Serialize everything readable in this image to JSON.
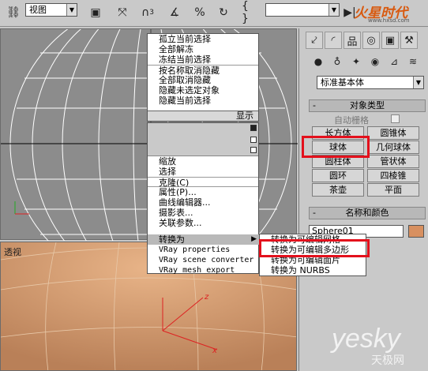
{
  "toolbar": {
    "view_select": "视图",
    "icons": [
      "select-object-icon",
      "move-icon",
      "angle-snap-icon",
      "percent-snap-icon",
      "spinner-snap-icon",
      "edit-named-selections-icon",
      "mirror-icon"
    ],
    "snap_count": "3",
    "selection_set": "",
    "brand": "火星时代",
    "brand_url": "www.hxsd.com"
  },
  "viewports": {
    "bottom_label": "透视"
  },
  "quad_menu": {
    "top_items": [
      "孤立当前选择",
      "全部解冻",
      "冻结当前选择",
      "按名称取消隐藏",
      "全部取消隐藏",
      "隐藏未选定对象",
      "隐藏当前选择"
    ],
    "display_header": "显示",
    "transform_items": [
      "缩放",
      "选择",
      "克隆(C)",
      "属性(P)...",
      "曲线编辑器...",
      "摄影表...",
      "关联参数..."
    ],
    "convert_to": "转换为",
    "vray_items": [
      "VRay properties",
      "VRay scene converter",
      "VRay mesh export"
    ],
    "submenu_items": [
      "转换为可编辑网格",
      "转换为可编辑多边形",
      "转换为可编辑面片",
      "转换为 NURBS"
    ]
  },
  "command_panel": {
    "category_dropdown": "标准基本体",
    "object_type_title": "对象类型",
    "autogrid_label": "自动栅格",
    "object_buttons": [
      "长方体",
      "圆锥体",
      "球体",
      "几何球体",
      "圆柱体",
      "管状体",
      "圆环",
      "四棱锥",
      "茶壶",
      "平面"
    ],
    "name_color_title": "名称和颜色",
    "object_name": "Sphere01"
  },
  "colors": {
    "highlight": "#e3101c",
    "viewport_gray": "#8c8c8c",
    "viewport_persp": "#c89a70",
    "object_color": "#d89060"
  },
  "watermark": {
    "logo": "yesky",
    "sub": "天极网"
  }
}
